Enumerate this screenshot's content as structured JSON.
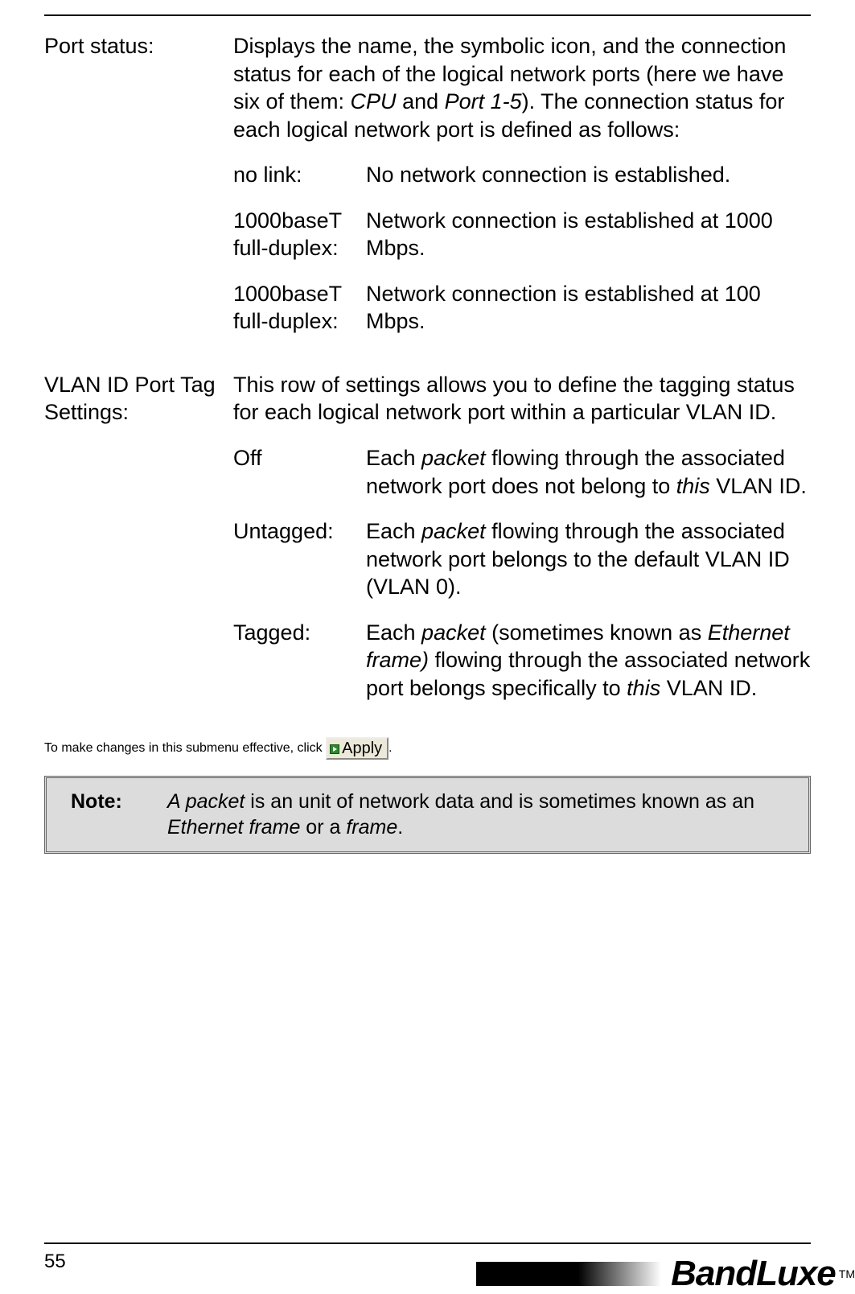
{
  "sections": [
    {
      "label": "Port status:",
      "intro_segments": [
        {
          "t": "Displays the name, the symbolic icon, and the connection status for each of the logical network ports (here we have six of them: "
        },
        {
          "t": "CPU",
          "i": true
        },
        {
          "t": " and "
        },
        {
          "t": "Port 1-5",
          "i": true
        },
        {
          "t": "). The connection status for each logical network port is defined as follows:"
        }
      ],
      "rows": [
        {
          "label": "no link:",
          "segments": [
            {
              "t": "No network connection is established."
            }
          ]
        },
        {
          "label": "1000baseT full-duplex:",
          "segments": [
            {
              "t": "Network connection is established at 1000 Mbps."
            }
          ]
        },
        {
          "label": "1000baseT full-duplex:",
          "segments": [
            {
              "t": "Network connection is established at 100 Mbps."
            }
          ]
        }
      ]
    },
    {
      "label": "VLAN ID Port Tag Settings:",
      "intro_segments": [
        {
          "t": "This row of settings allows you to define the tagging status for each logical network port within a particular VLAN ID."
        }
      ],
      "rows": [
        {
          "label": "Off",
          "segments": [
            {
              "t": "Each "
            },
            {
              "t": "packet",
              "i": true
            },
            {
              "t": " flowing through the associated network port does not belong to "
            },
            {
              "t": "this",
              "i": true
            },
            {
              "t": " VLAN ID."
            }
          ]
        },
        {
          "label": "Untagged:",
          "segments": [
            {
              "t": "Each "
            },
            {
              "t": "packet",
              "i": true
            },
            {
              "t": " flowing through the associated network port belongs to the default VLAN ID (VLAN 0)."
            }
          ]
        },
        {
          "label": "Tagged:",
          "segments": [
            {
              "t": "Each "
            },
            {
              "t": "packet",
              "i": true
            },
            {
              "t": " (sometimes known as "
            },
            {
              "t": "Ethernet frame)",
              "i": true
            },
            {
              "t": " flowing through the associated network port belongs specifically to "
            },
            {
              "t": "this",
              "i": true
            },
            {
              "t": " VLAN ID."
            }
          ]
        }
      ]
    }
  ],
  "apply_line_prefix": "To make changes in this submenu effective, click ",
  "apply_button_label": "Apply",
  "apply_line_suffix": ".",
  "note": {
    "label": "Note:",
    "segments": [
      {
        "t": "A packet",
        "i": true
      },
      {
        "t": " is an unit of network data and is sometimes known as an "
      },
      {
        "t": "Ethernet frame",
        "i": true
      },
      {
        "t": " or a "
      },
      {
        "t": "frame",
        "i": true
      },
      {
        "t": "."
      }
    ]
  },
  "page_number": "55",
  "brand": "BandLuxe",
  "brand_tm": "TM"
}
